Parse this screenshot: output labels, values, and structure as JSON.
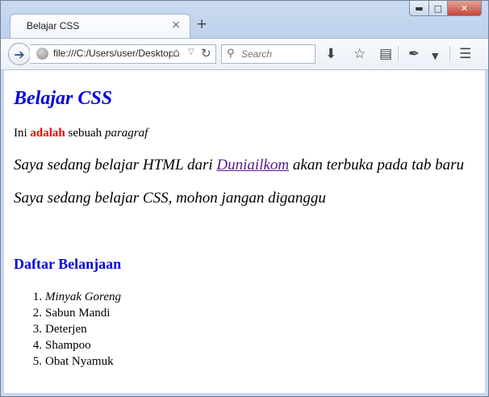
{
  "browser": {
    "tab_title": "Belajar CSS",
    "tab_close": "×",
    "new_tab": "+",
    "url": "file:///C:/Users/user/Desktop",
    "search_placeholder": "Search"
  },
  "page": {
    "heading": "Belajar CSS",
    "para1": {
      "before": "Ini ",
      "bold": "adalah",
      "middle": " sebuah ",
      "italic": "paragraf"
    },
    "para2": {
      "before": "Saya sedang belajar HTML dari ",
      "link": "Duniailkom",
      "after": " akan terbuka pada tab baru"
    },
    "para3": "Saya sedang belajar CSS, mohon jangan diganggu",
    "list_heading": "Daftar Belanjaan",
    "list": [
      {
        "num": "1.",
        "text": "Minyak Goreng"
      },
      {
        "num": "2.",
        "text": "Sabun Mandi"
      },
      {
        "num": "3.",
        "text": "Deterjen"
      },
      {
        "num": "4.",
        "text": "Shampoo"
      },
      {
        "num": "5.",
        "text": "Obat Nyamuk"
      }
    ]
  },
  "colors": {
    "heading": "#0000dd",
    "bold_word": "#ee0000",
    "link_visited": "#551a8b"
  }
}
